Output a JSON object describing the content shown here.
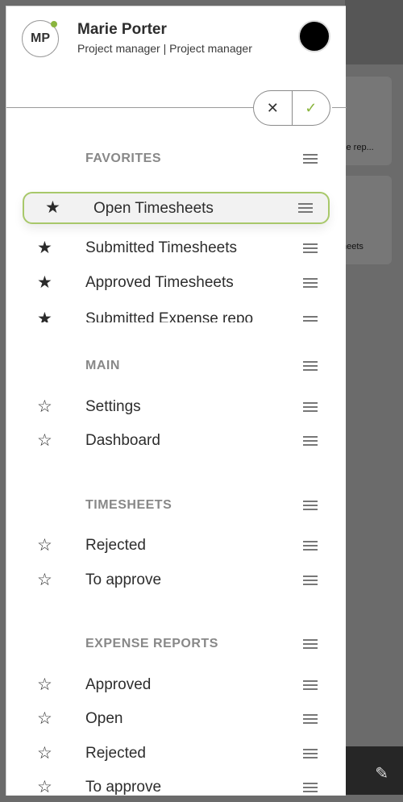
{
  "background": {
    "cards": [
      "se rep...",
      "heets"
    ]
  },
  "profile": {
    "initials": "MP",
    "name": "Marie Porter",
    "role": "Project manager | Project manager"
  },
  "edit_controls": {
    "cancel_symbol": "✕",
    "confirm_symbol": "✓"
  },
  "sections": {
    "favorites": {
      "title": "FAVORITES",
      "items": [
        "Open Timesheets",
        "Submitted Timesheets",
        "Approved Timesheets",
        "Submitted Expense repo"
      ]
    },
    "main": {
      "title": "MAIN",
      "items": [
        "Settings",
        "Dashboard"
      ]
    },
    "timesheets": {
      "title": "TIMESHEETS",
      "items": [
        "Rejected",
        "To approve"
      ]
    },
    "expense_reports": {
      "title": "EXPENSE REPORTS",
      "items": [
        "Approved",
        "Open",
        "Rejected",
        "To approve"
      ]
    }
  },
  "icons": {
    "filled_star": "★",
    "outline_star": "☆",
    "pencil": "✎"
  },
  "colors": {
    "accent": "#8ab53e",
    "highlight_border": "#a8c86a",
    "section_title": "#888888"
  }
}
